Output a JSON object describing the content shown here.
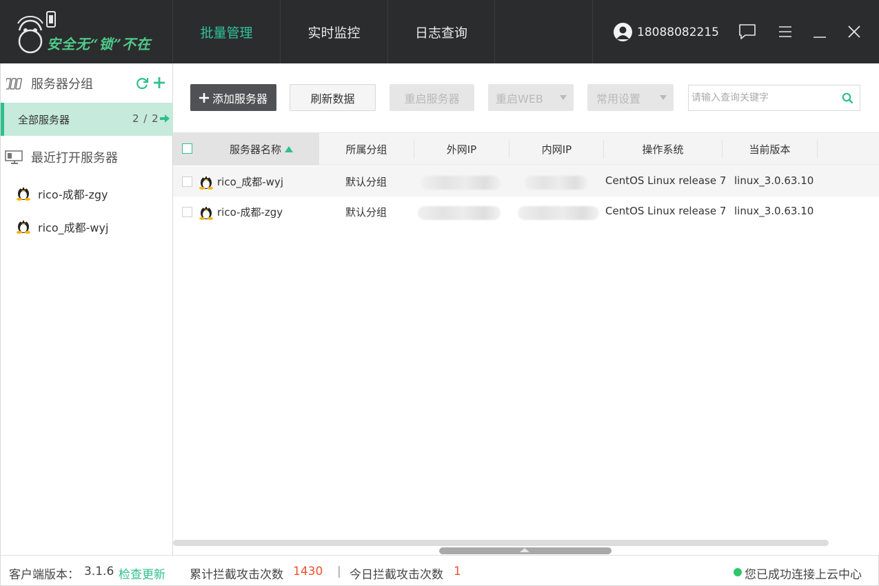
{
  "app": {
    "logo_text": "安全无“锁”不在"
  },
  "nav": {
    "tabs": [
      {
        "label": "批量管理",
        "active": true
      },
      {
        "label": "实时监控",
        "active": false
      },
      {
        "label": "日志查询",
        "active": false
      }
    ]
  },
  "user": {
    "phone": "18088082215",
    "icons": [
      "user-avatar-icon",
      "message-icon",
      "menu-icon",
      "minimize-icon",
      "close-icon"
    ]
  },
  "sidebar": {
    "group_title": "服务器分组",
    "group_icons": [
      "server-group-icon",
      "refresh-icon",
      "add-icon"
    ],
    "groups": [
      {
        "label": "全部服务器",
        "count": "2 / 2"
      }
    ],
    "recent_title": "最近打开服务器",
    "recent_servers": [
      {
        "name": "rico-成都-zgy",
        "icon": "linux-penguin-icon"
      },
      {
        "name": "rico_成都-wyj",
        "icon": "linux-penguin-icon"
      }
    ]
  },
  "toolbar": {
    "add_server": "添加服务器",
    "refresh_data": "刷新数据",
    "restart_server": "重启服务器",
    "restart_web": "重启WEB",
    "common_settings": "常用设置",
    "search_placeholder": "请输入查询关键字"
  },
  "table": {
    "columns": [
      "服务器名称",
      "所属分组",
      "外网IP",
      "内网IP",
      "操作系统",
      "当前版本"
    ],
    "sorted_column": "服务器名称",
    "sort_direction": "asc",
    "rows": [
      {
        "name": "rico_成都-wyj",
        "group": "默认分组",
        "external_ip": "",
        "internal_ip": "",
        "os": "CentOS Linux release 7",
        "version": "linux_3.0.63.10"
      },
      {
        "name": "rico-成都-zgy",
        "group": "默认分组",
        "external_ip": "",
        "internal_ip": "",
        "os": "CentOS Linux release 7",
        "version": "linux_3.0.63.10"
      }
    ]
  },
  "footer": {
    "client_version_label": "客户端版本：",
    "client_version": "3.1.6",
    "check_update": "检查更新",
    "total_blocked_label": "累计拦截攻击次数",
    "total_blocked": "1430",
    "divider": "|",
    "today_blocked_label": "今日拦截攻击次数",
    "today_blocked": "1",
    "connection_status": "您已成功连接上云中心"
  },
  "colors": {
    "accent": "#2fbf8f",
    "topbar": "#2b2c2e",
    "number_highlight": "#e7532f",
    "status_ok": "#2ec76a"
  }
}
